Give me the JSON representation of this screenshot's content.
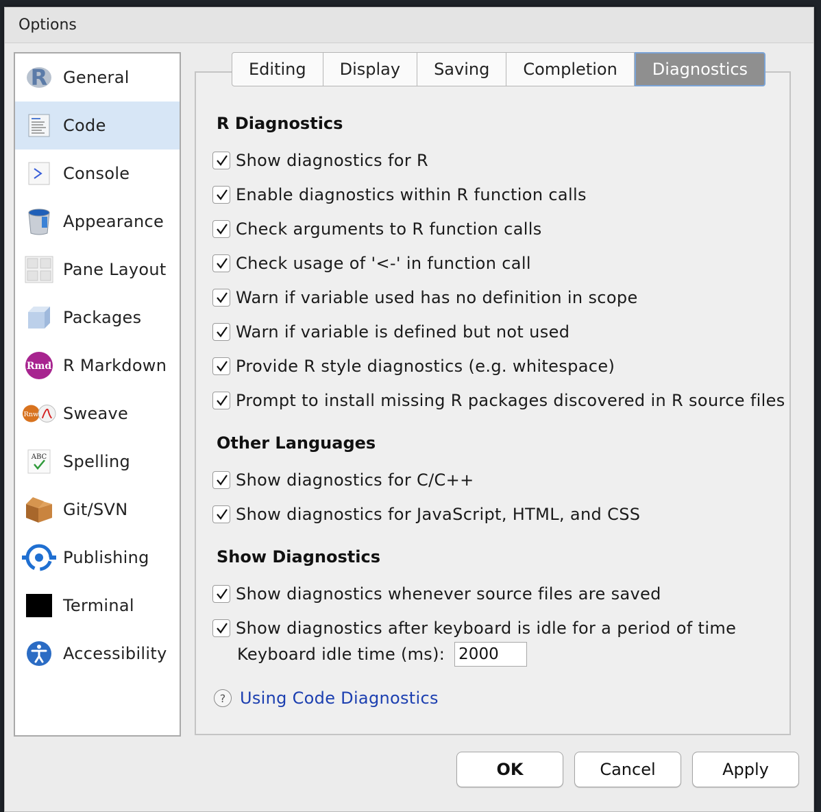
{
  "window": {
    "title": "Options"
  },
  "sidebar": {
    "items": [
      {
        "label": "General",
        "icon": "r-logo-icon"
      },
      {
        "label": "Code",
        "icon": "code-document-icon",
        "selected": true
      },
      {
        "label": "Console",
        "icon": "console-icon"
      },
      {
        "label": "Appearance",
        "icon": "paint-bucket-icon"
      },
      {
        "label": "Pane Layout",
        "icon": "pane-layout-icon"
      },
      {
        "label": "Packages",
        "icon": "package-cube-icon"
      },
      {
        "label": "R Markdown",
        "icon": "rmd-icon",
        "icon_text": "Rmd"
      },
      {
        "label": "Sweave",
        "icon": "sweave-icon",
        "icon_text": "Rnw"
      },
      {
        "label": "Spelling",
        "icon": "spellcheck-icon",
        "icon_text": "ABC"
      },
      {
        "label": "Git/SVN",
        "icon": "box-icon"
      },
      {
        "label": "Publishing",
        "icon": "publishing-icon"
      },
      {
        "label": "Terminal",
        "icon": "terminal-icon"
      },
      {
        "label": "Accessibility",
        "icon": "accessibility-icon"
      }
    ]
  },
  "tabs": [
    {
      "label": "Editing"
    },
    {
      "label": "Display"
    },
    {
      "label": "Saving"
    },
    {
      "label": "Completion"
    },
    {
      "label": "Diagnostics",
      "active": true
    }
  ],
  "sections": {
    "r_diagnostics": {
      "title": "R Diagnostics",
      "options": [
        {
          "label": "Show diagnostics for R",
          "checked": true
        },
        {
          "label": "Enable diagnostics within R function calls",
          "checked": true
        },
        {
          "label": "Check arguments to R function calls",
          "checked": true
        },
        {
          "label": "Check usage of '<-' in function call",
          "checked": true
        },
        {
          "label": "Warn if variable used has no definition in scope",
          "checked": true
        },
        {
          "label": "Warn if variable is defined but not used",
          "checked": true
        },
        {
          "label": "Provide R style diagnostics (e.g. whitespace)",
          "checked": true
        },
        {
          "label": "Prompt to install missing R packages discovered in R source files",
          "checked": true
        }
      ]
    },
    "other_languages": {
      "title": "Other Languages",
      "options": [
        {
          "label": "Show diagnostics for C/C++",
          "checked": true
        },
        {
          "label": "Show diagnostics for JavaScript, HTML, and CSS",
          "checked": true
        }
      ]
    },
    "show_diagnostics": {
      "title": "Show Diagnostics",
      "options": [
        {
          "label": "Show diagnostics whenever source files are saved",
          "checked": true
        },
        {
          "label": "Show diagnostics after keyboard is idle for a period of time",
          "checked": true
        }
      ],
      "idle_label": "Keyboard idle time (ms):",
      "idle_value": "2000"
    }
  },
  "help": {
    "icon_text": "?",
    "link": "Using Code Diagnostics"
  },
  "buttons": {
    "ok": "OK",
    "cancel": "Cancel",
    "apply": "Apply"
  },
  "colors": {
    "selected_sidebar": "#d7e6f6",
    "active_tab": "#8f8f8f",
    "link": "#1c3fb0"
  }
}
